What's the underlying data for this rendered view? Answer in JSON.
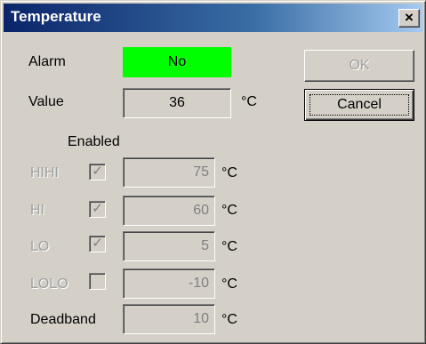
{
  "window": {
    "title": "Temperature",
    "close_glyph": "×"
  },
  "alarm": {
    "label": "Alarm",
    "value": "No",
    "color": "#00ff00"
  },
  "value": {
    "label": "Value",
    "reading": "36",
    "unit": "°C"
  },
  "enabled_header": "Enabled",
  "limits": [
    {
      "label": "HIHI",
      "checked": true,
      "value": "75",
      "unit": "°C"
    },
    {
      "label": "HI",
      "checked": true,
      "value": "60",
      "unit": "°C"
    },
    {
      "label": "LO",
      "checked": true,
      "value": "5",
      "unit": "°C"
    },
    {
      "label": "LOLO",
      "checked": false,
      "value": "-10",
      "unit": "°C"
    }
  ],
  "deadband": {
    "label": "Deadband",
    "value": "10",
    "unit": "°C"
  },
  "buttons": {
    "ok": "OK",
    "cancel": "Cancel"
  },
  "checkmark_glyph": "✓"
}
